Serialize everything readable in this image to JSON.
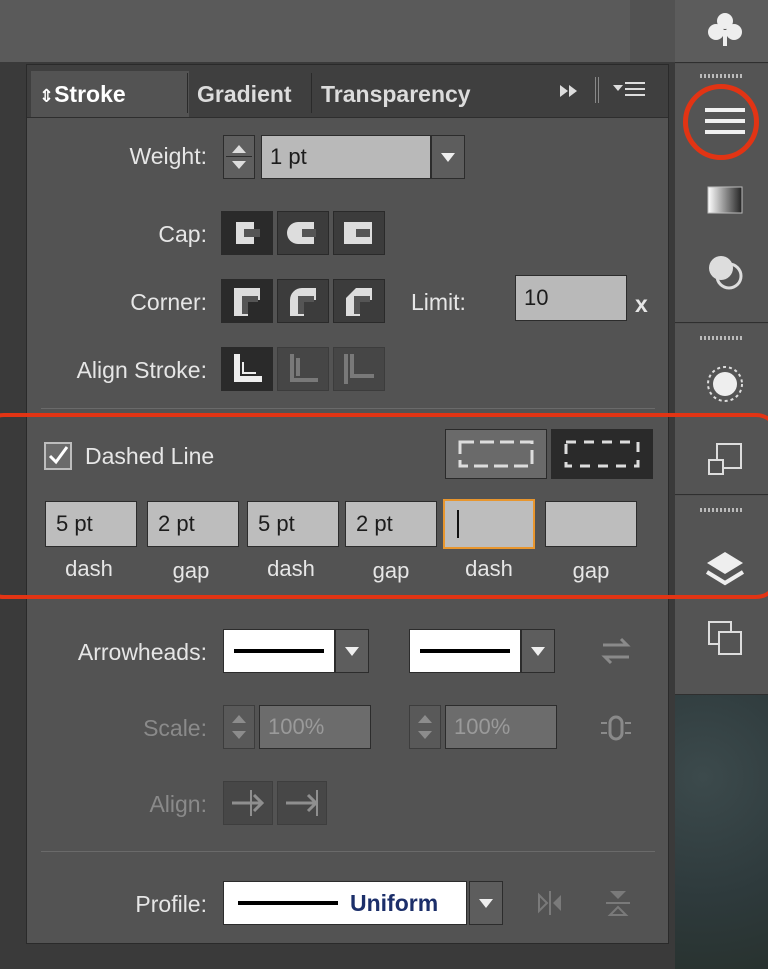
{
  "panel": {
    "tabs": [
      {
        "label": "Stroke",
        "active": true
      },
      {
        "label": "Gradient",
        "active": false
      },
      {
        "label": "Transparency",
        "active": false
      }
    ],
    "weight": {
      "label": "Weight:",
      "value": "1 pt"
    },
    "cap": {
      "label": "Cap:"
    },
    "corner": {
      "label": "Corner:",
      "limit_label": "Limit:",
      "limit_value": "10",
      "limit_unit": "x"
    },
    "align_stroke": {
      "label": "Align Stroke:"
    },
    "dashed": {
      "label": "Dashed Line",
      "checked": true,
      "fields": [
        {
          "value": "5 pt",
          "label": "dash"
        },
        {
          "value": "2 pt",
          "label": "gap"
        },
        {
          "value": "5 pt",
          "label": "dash"
        },
        {
          "value": "2 pt",
          "label": "gap"
        },
        {
          "value": "",
          "label": "dash"
        },
        {
          "value": "",
          "label": "gap"
        }
      ]
    },
    "arrowheads": {
      "label": "Arrowheads:"
    },
    "scale": {
      "label": "Scale:",
      "start": "100%",
      "end": "100%"
    },
    "align": {
      "label": "Align:"
    },
    "profile": {
      "label": "Profile:",
      "value": "Uniform"
    }
  },
  "dock": {
    "icons": [
      "club-icon",
      "stroke-panel-icon",
      "gradient-icon",
      "transparency-icon",
      "appearance-icon",
      "transform-icon",
      "layers-icon",
      "artboards-icon"
    ]
  },
  "colors": {
    "highlight": "#e23414",
    "panel": "#535353",
    "tabbar": "#3f3f3f"
  }
}
